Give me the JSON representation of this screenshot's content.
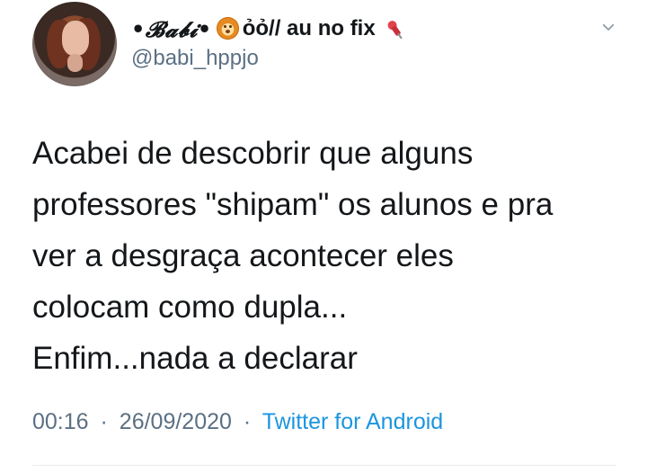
{
  "tweet": {
    "display_name": "•𝓑𝓪𝓫𝓲•",
    "display_name_extra": "ỏỏ// au no fix",
    "username": "@babi_hppjo",
    "text_lines": [
      "Acabei de descobrir que alguns",
      "professores \"shipam\" os alunos e pra",
      "ver a desgraça acontecer eles",
      "colocam como dupla...",
      "Enfim...nada a declarar"
    ],
    "time": "00:16",
    "date": "26/09/2020",
    "source": "Twitter for Android",
    "separator": "·"
  },
  "icons": {
    "lion": "lion-face-icon",
    "pin": "pushpin-icon",
    "chevron": "chevron-down-icon"
  },
  "colors": {
    "background": "#ffffff",
    "text": "#14171a",
    "muted": "#5b7083",
    "link": "#1b95e0",
    "divider": "#e6ecf0"
  }
}
